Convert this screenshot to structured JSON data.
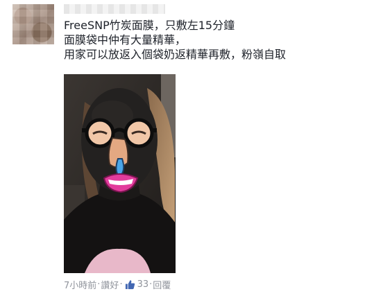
{
  "post": {
    "lines": [
      "FreeSNP竹炭面膜，只敷左15分鐘",
      "面膜袋中仲有大量精華，",
      "用家可以放返入個袋奶返精華再敷，粉嶺自取"
    ]
  },
  "footer": {
    "time": "7小時前",
    "like_label": "讚好",
    "like_count": "33",
    "reply_label": "回覆",
    "separator": "·"
  },
  "colors": {
    "text": "#1d2129",
    "meta": "#90949c",
    "like_icon": "#4267b2"
  },
  "icons": {
    "like": "thumbs-up-icon"
  }
}
